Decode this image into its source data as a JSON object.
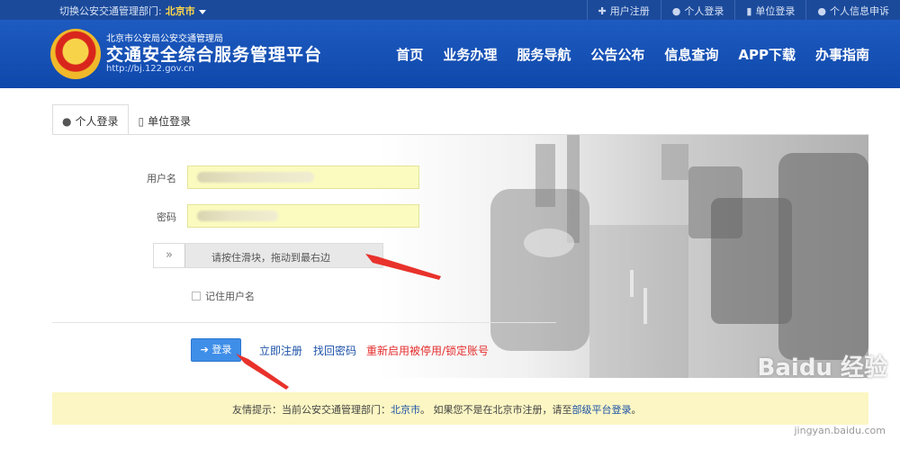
{
  "topbar": {
    "switch_label": "切换公安交通管理部门:",
    "current_city": "北京市",
    "links": [
      {
        "icon": "plus-icon",
        "label": "用户注册"
      },
      {
        "icon": "user-icon",
        "label": "个人登录"
      },
      {
        "icon": "building-icon",
        "label": "单位登录"
      },
      {
        "icon": "user-icon",
        "label": "个人信息申诉"
      }
    ]
  },
  "header": {
    "org_sub": "北京市公安局公安交通管理局",
    "title": "交通安全综合服务管理平台",
    "url": "http://bj.122.gov.cn",
    "nav": [
      "首页",
      "业务办理",
      "服务导航",
      "公告公布",
      "信息查询",
      "APP下载",
      "办事指南"
    ]
  },
  "tabs": [
    {
      "icon": "user-icon",
      "label": "个人登录"
    },
    {
      "icon": "building-icon",
      "label": "单位登录"
    }
  ],
  "form": {
    "username_label": "用户名",
    "password_label": "密码",
    "slider_handle": "»",
    "slider_hint": "请按住滑块，拖动到最右边",
    "remember_label": "记住用户名"
  },
  "actions": {
    "login_label": "登录",
    "register_label": "立即注册",
    "recover_label": "找回密码",
    "reactivate_label": "重新启用被停用/锁定账号"
  },
  "notice": {
    "prefix": "友情提示：当前公安交通管理部门：",
    "city": "北京市",
    "middle": "。 如果您不是在北京市注册，请至",
    "link": "部级平台登录",
    "suffix": "。"
  },
  "watermark": {
    "main": "Baidu 经验",
    "sub": "jingyan.baidu.com"
  },
  "colors": {
    "header_blue": "#1e5bc0",
    "topbar_blue": "#1b4a9b",
    "login_button": "#3f8ee8",
    "input_yellow": "#fbfbc0",
    "notice_yellow": "#fbf6c3",
    "red_link": "#e52d2d",
    "arrow_red": "#e8322b"
  }
}
